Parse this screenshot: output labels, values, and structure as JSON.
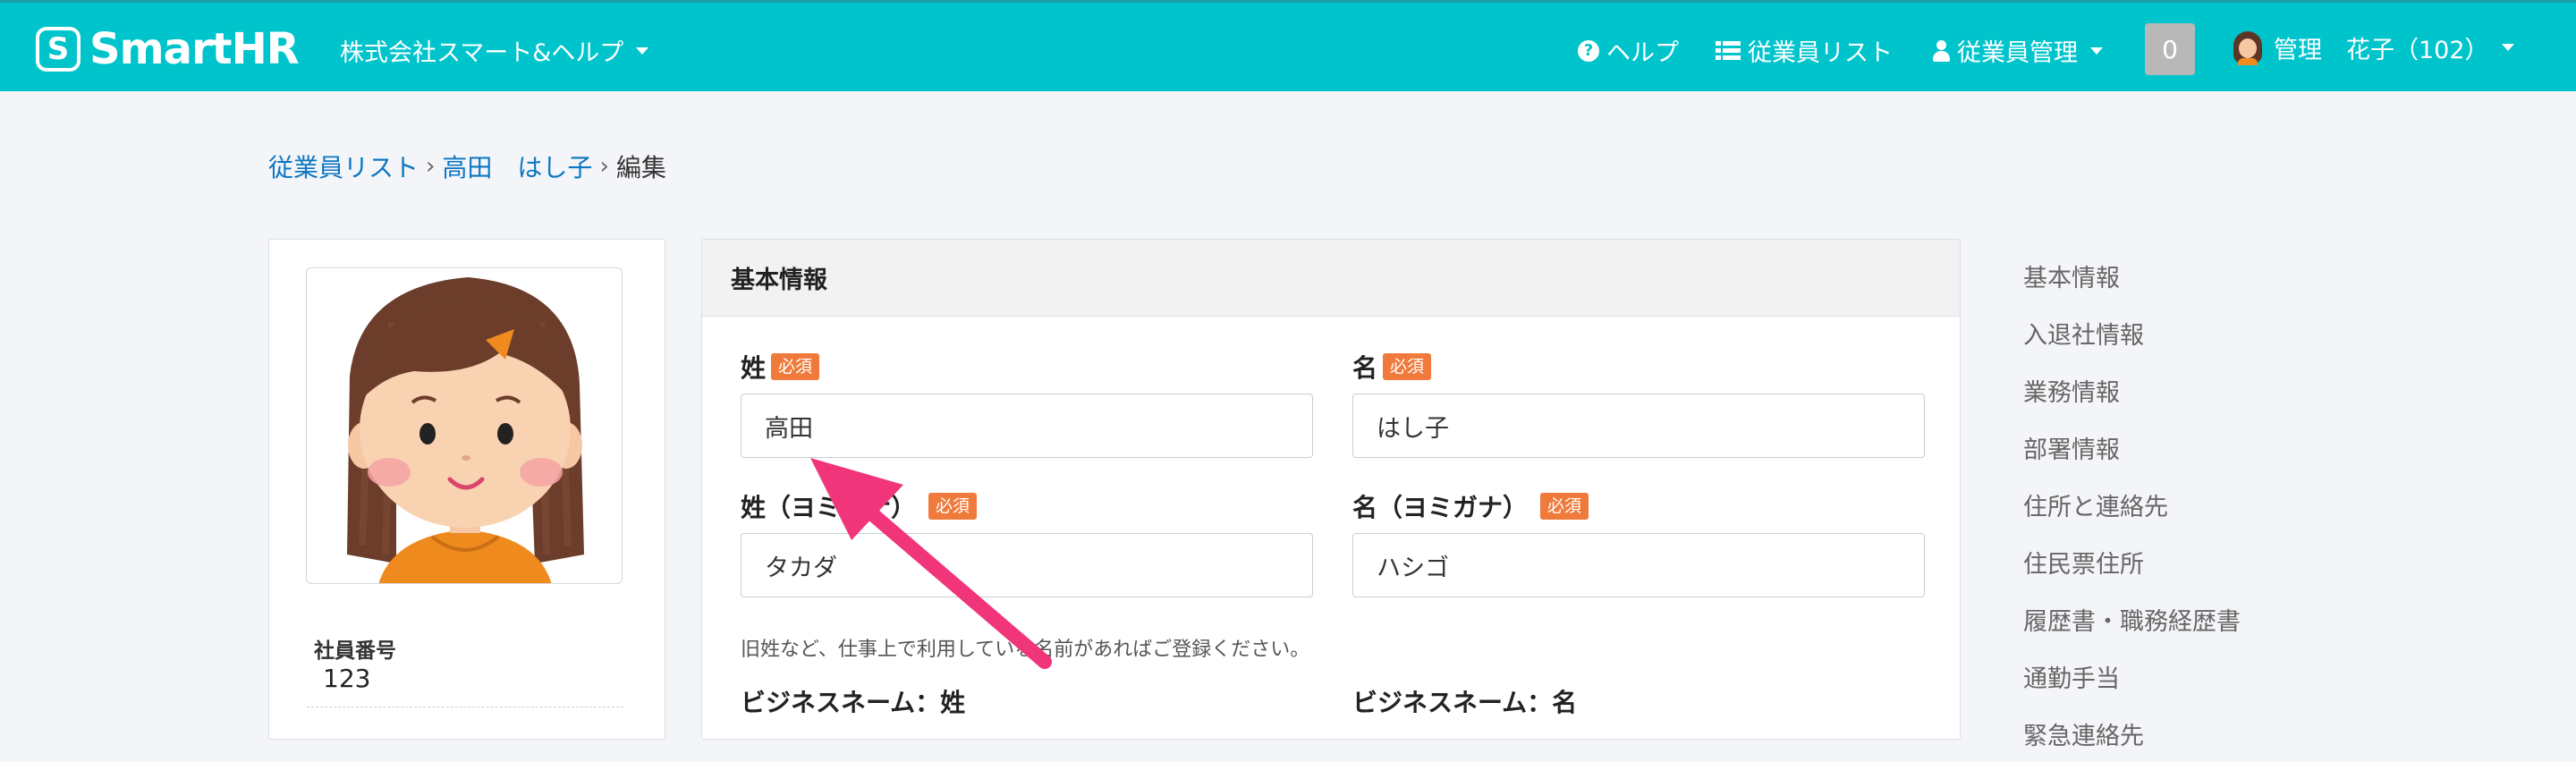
{
  "header": {
    "logo_text": "SmartHR",
    "logo_mark": "S",
    "company": "株式会社スマート&ヘルプ",
    "nav": {
      "help": "ヘルプ",
      "employee_list": "従業員リスト",
      "employee_admin": "従業員管理"
    },
    "notification_count": "0",
    "user_name": "管理　花子（102）"
  },
  "breadcrumb": {
    "items": [
      "従業員リスト",
      "高田　はし子"
    ],
    "current": "編集"
  },
  "profile": {
    "employee_number_label": "社員番号",
    "employee_number": "123"
  },
  "form": {
    "section_title": "基本情報",
    "required_badge": "必須",
    "last_name_label": "姓",
    "last_name_value": "高田",
    "first_name_label": "名",
    "first_name_value": "はし子",
    "last_name_kana_label": "姓（ヨミガナ）",
    "last_name_kana_value": "タカダ",
    "first_name_kana_label": "名（ヨミガナ）",
    "first_name_kana_value": "ハシゴ",
    "business_name_hint": "旧姓など、仕事上で利用している名前があればご登録ください。",
    "business_last_label": "ビジネスネーム：姓",
    "business_first_label": "ビジネスネーム：名"
  },
  "side_nav": {
    "items": [
      "基本情報",
      "入退社情報",
      "業務情報",
      "部署情報",
      "住所と連絡先",
      "住民票住所",
      "履歴書・職務経歴書",
      "通勤手当",
      "緊急連絡先"
    ]
  },
  "colors": {
    "brand": "#00c4cc",
    "required": "#ef7a3b",
    "link": "#0c77c2",
    "annotation_arrow": "#f0357a"
  }
}
